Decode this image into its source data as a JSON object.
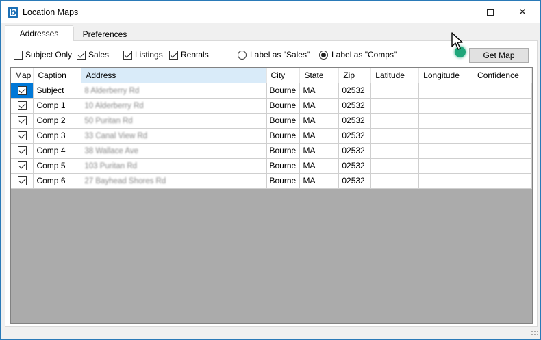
{
  "window": {
    "title": "Location Maps",
    "controls": {
      "minimize": "minimize-icon",
      "maximize": "maximize-icon",
      "close": "close-icon"
    }
  },
  "tabs": [
    {
      "label": "Addresses",
      "active": true
    },
    {
      "label": "Preferences",
      "active": false
    }
  ],
  "filters": {
    "subject_only": {
      "label": "Subject Only",
      "checked": false
    },
    "sales": {
      "label": "Sales",
      "checked": true
    },
    "listings": {
      "label": "Listings",
      "checked": true
    },
    "rentals": {
      "label": "Rentals",
      "checked": true
    }
  },
  "label_mode": {
    "sales": {
      "label": "Label as \"Sales\"",
      "selected": false
    },
    "comps": {
      "label": "Label as \"Comps\"",
      "selected": true
    }
  },
  "toolbar": {
    "get_map_label": "Get Map"
  },
  "grid": {
    "columns": [
      "Map",
      "Caption",
      "Address",
      "City",
      "State",
      "Zip",
      "Latitude",
      "Longitude",
      "Confidence"
    ],
    "rows": [
      {
        "map": true,
        "caption": "Subject",
        "address": "8 Alderberry Rd",
        "city": "Bourne",
        "state": "MA",
        "zip": "02532",
        "latitude": "",
        "longitude": "",
        "confidence": ""
      },
      {
        "map": true,
        "caption": "Comp 1",
        "address": "10 Alderberry Rd",
        "city": "Bourne",
        "state": "MA",
        "zip": "02532",
        "latitude": "",
        "longitude": "",
        "confidence": ""
      },
      {
        "map": true,
        "caption": "Comp 2",
        "address": "50 Puritan Rd",
        "city": "Bourne",
        "state": "MA",
        "zip": "02532",
        "latitude": "",
        "longitude": "",
        "confidence": ""
      },
      {
        "map": true,
        "caption": "Comp 3",
        "address": "33 Canal View Rd",
        "city": "Bourne",
        "state": "MA",
        "zip": "02532",
        "latitude": "",
        "longitude": "",
        "confidence": ""
      },
      {
        "map": true,
        "caption": "Comp 4",
        "address": "38 Wallace Ave",
        "city": "Bourne",
        "state": "MA",
        "zip": "02532",
        "latitude": "",
        "longitude": "",
        "confidence": ""
      },
      {
        "map": true,
        "caption": "Comp 5",
        "address": "103 Puritan Rd",
        "city": "Bourne",
        "state": "MA",
        "zip": "02532",
        "latitude": "",
        "longitude": "",
        "confidence": ""
      },
      {
        "map": true,
        "caption": "Comp 6",
        "address": "27 Bayhead Shores Rd",
        "city": "Bourne",
        "state": "MA",
        "zip": "02532",
        "latitude": "",
        "longitude": "",
        "confidence": ""
      }
    ]
  },
  "colors": {
    "accent": "#0078d7",
    "grid_empty": "#ababab",
    "header_selected": "#d9ebf9",
    "cursor_highlight": "#1fa67a"
  }
}
